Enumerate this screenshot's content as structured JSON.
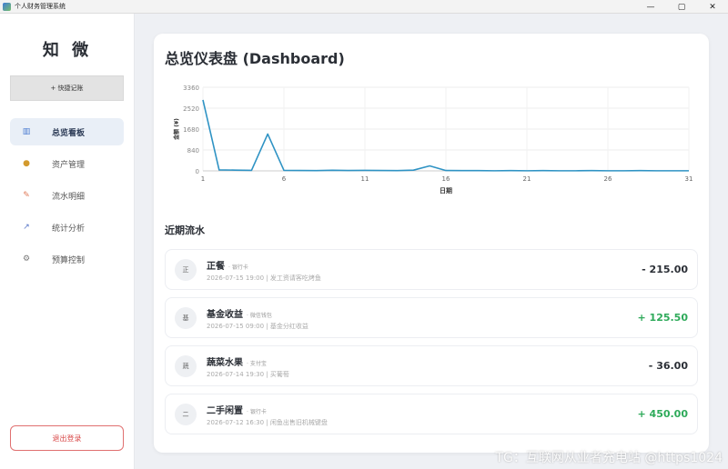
{
  "window": {
    "title": "个人财务管理系统",
    "minimize": "—",
    "maximize": "▢",
    "close": "✕"
  },
  "sidebar": {
    "logo": "知 微",
    "quick_button": "+ 快捷记账",
    "items": [
      {
        "label": "总览看板",
        "icon": "bar-chart-icon",
        "glyph": "▥",
        "color": "#4a7bd0",
        "active": true
      },
      {
        "label": "资产管理",
        "icon": "money-bag-icon",
        "glyph": "●",
        "color": "#d39a2e",
        "active": false
      },
      {
        "label": "流水明细",
        "icon": "memo-icon",
        "glyph": "✎",
        "color": "#e07b5a",
        "active": false
      },
      {
        "label": "统计分析",
        "icon": "trend-chart-icon",
        "glyph": "↗",
        "color": "#5a78c8",
        "active": false
      },
      {
        "label": "预算控制",
        "icon": "gear-icon",
        "glyph": "⚙",
        "color": "#777777",
        "active": false
      }
    ],
    "logout": "退出登录"
  },
  "main": {
    "title": "总览仪表盘 (Dashboard)",
    "recent_title": "近期流水"
  },
  "chart_data": {
    "type": "line",
    "title": "",
    "xlabel": "日期",
    "ylabel": "金额 (¥)",
    "x": [
      1,
      2,
      3,
      4,
      5,
      6,
      7,
      8,
      9,
      10,
      11,
      12,
      13,
      14,
      15,
      16,
      17,
      18,
      19,
      20,
      21,
      22,
      23,
      24,
      25,
      26,
      27,
      28,
      29,
      30,
      31
    ],
    "values": [
      2850,
      40,
      30,
      20,
      1480,
      20,
      15,
      10,
      25,
      15,
      20,
      15,
      10,
      30,
      200,
      15,
      10,
      10,
      5,
      10,
      5,
      10,
      5,
      5,
      10,
      5,
      5,
      10,
      5,
      5,
      5
    ],
    "x_ticks": [
      1,
      6,
      11,
      16,
      21,
      26,
      31
    ],
    "y_ticks": [
      0,
      840,
      1680,
      2520,
      3360
    ],
    "xlim": [
      1,
      31
    ],
    "ylim": [
      0,
      3360
    ],
    "grid": true,
    "color": "#2f93c4"
  },
  "transactions": [
    {
      "avatar": "正",
      "name": "正餐",
      "account": "· 银行卡",
      "meta": "2026-07-15 19:00 | 发工资请客吃烤鱼",
      "amount": "- 215.00",
      "type": "neg"
    },
    {
      "avatar": "基",
      "name": "基金收益",
      "account": "· 微信钱包",
      "meta": "2026-07-15 09:00 | 基金分红收益",
      "amount": "+ 125.50",
      "type": "pos"
    },
    {
      "avatar": "蔬",
      "name": "蔬菜水果",
      "account": "· 支付宝",
      "meta": "2026-07-14 19:30 | 买葡萄",
      "amount": "- 36.00",
      "type": "neg"
    },
    {
      "avatar": "二",
      "name": "二手闲置",
      "account": "· 银行卡",
      "meta": "2026-07-12 16:30 | 闲鱼出售旧机械键盘",
      "amount": "+ 450.00",
      "type": "pos"
    }
  ],
  "watermark": "TG：互联网从业者充电站 @https1024"
}
